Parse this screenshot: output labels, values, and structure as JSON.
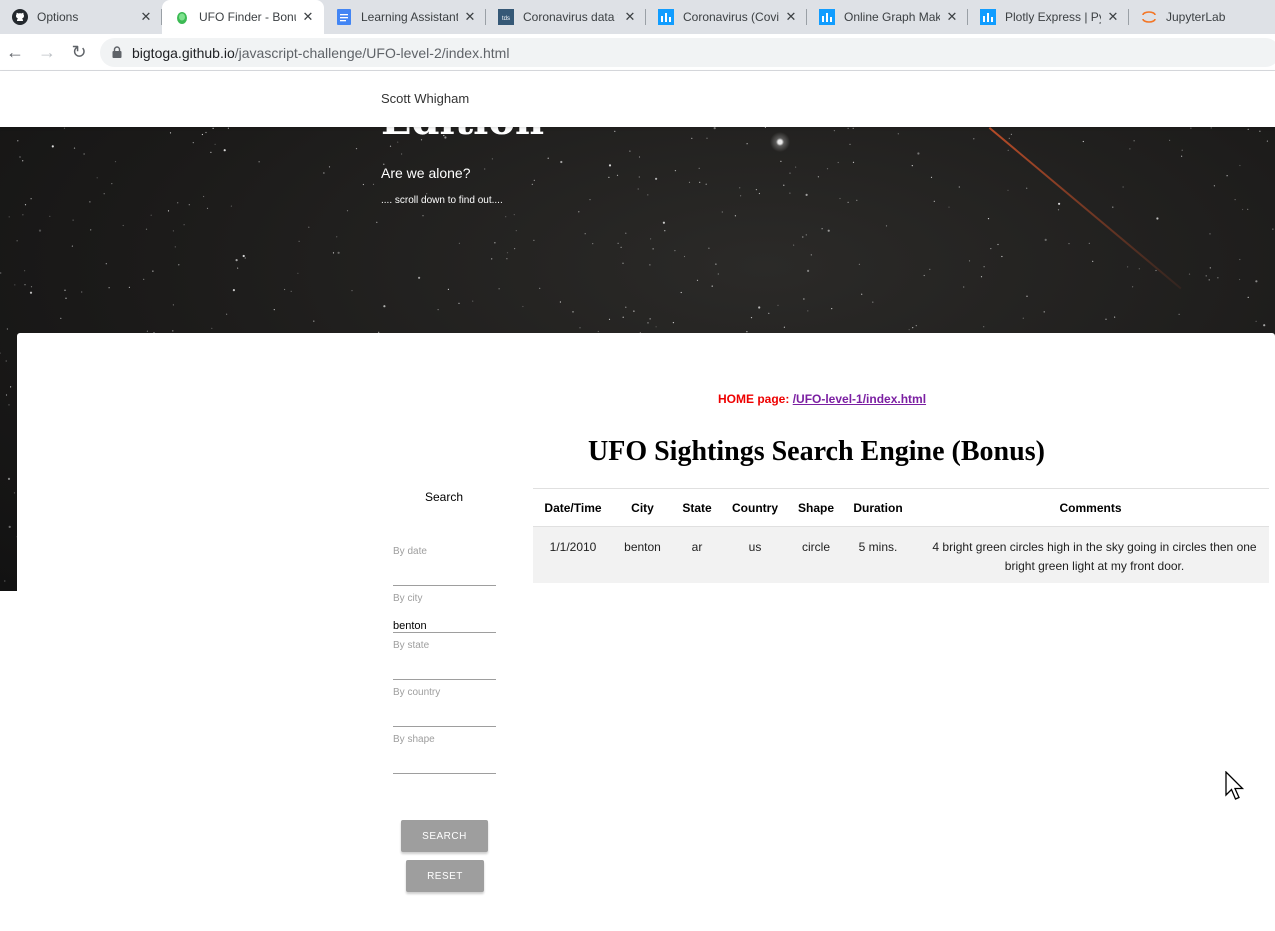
{
  "browser": {
    "tabs": [
      {
        "label": "Options",
        "icon": "github-icon",
        "active": false
      },
      {
        "label": "UFO Finder - Bonus",
        "icon": "ufo-icon",
        "active": true
      },
      {
        "label": "Learning Assistant",
        "icon": "docs-icon",
        "active": false
      },
      {
        "label": "Coronavirus data v",
        "icon": "tds-icon",
        "active": false
      },
      {
        "label": "Coronavirus (Covi",
        "icon": "chart-studio-icon",
        "active": false
      },
      {
        "label": "Online Graph Mak",
        "icon": "chart-studio-icon",
        "active": false
      },
      {
        "label": "Plotly Express | Py",
        "icon": "chart-studio-icon",
        "active": false
      },
      {
        "label": "JupyterLab",
        "icon": "jupyter-icon",
        "active": false
      }
    ],
    "url_host": "bigtoga.github.io",
    "url_path": "/javascript-challenge/UFO-level-2/index.html"
  },
  "site": {
    "brand": "Scott Whigham",
    "hero_title": "Edition",
    "hero_subtitle": "Are we alone?",
    "hero_hint": ".... scroll down to find out...."
  },
  "main": {
    "home_label": "HOME page:",
    "home_link": "/UFO-level-1/index.html",
    "title": "UFO Sightings Search Engine (Bonus)"
  },
  "search": {
    "heading": "Search",
    "fields": [
      {
        "label": "By date",
        "value": ""
      },
      {
        "label": "By city",
        "value": "benton"
      },
      {
        "label": "By state",
        "value": ""
      },
      {
        "label": "By country",
        "value": ""
      },
      {
        "label": "By shape",
        "value": ""
      }
    ],
    "search_button": "SEARCH",
    "reset_button": "RESET"
  },
  "table": {
    "headers": [
      "Date/Time",
      "City",
      "State",
      "Country",
      "Shape",
      "Duration",
      "Comments"
    ],
    "rows": [
      [
        "1/1/2010",
        "benton",
        "ar",
        "us",
        "circle",
        "5 mins.",
        "4 bright green circles high in the sky going in circles then one bright green light at my front door."
      ]
    ]
  }
}
